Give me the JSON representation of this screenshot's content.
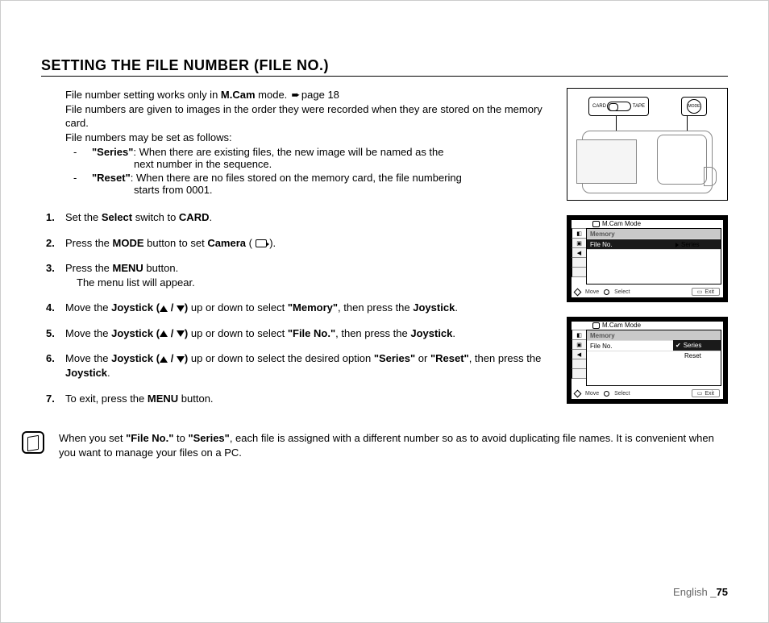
{
  "title": "SETTING THE FILE NUMBER (FILE NO.)",
  "intro": {
    "l1a": "File number setting works only in ",
    "l1b": "M.Cam",
    "l1c": " mode. ",
    "l1d": "page 18",
    "l2": "File numbers are given to images in the order they were recorded when they are stored on the memory card.",
    "l3": "File numbers may be set as follows:"
  },
  "options": [
    {
      "name": "\"Series\"",
      "desc1": ": When there are existing files, the new image will be named as the",
      "desc2": "next number in the sequence."
    },
    {
      "name": "\"Reset\"",
      "desc1": ": When there are no files stored on the memory card, the file numbering",
      "desc2": "starts from 0001."
    }
  ],
  "steps": {
    "s1a": "Set the ",
    "s1b": "Select",
    "s1c": " switch to ",
    "s1d": "CARD",
    "s1e": ".",
    "s2a": "Press the ",
    "s2b": "MODE",
    "s2c": " button to set ",
    "s2d": "Camera",
    "s2e": " ( ",
    "s2f": " ).",
    "s3a": "Press the ",
    "s3b": "MENU",
    "s3c": " button.",
    "s3sub": "The menu list will appear.",
    "s4a": "Move the ",
    "s4b": "Joystick (",
    "s4c": " / ",
    "s4d": ")",
    "s4e": " up or down to select ",
    "s4f": "\"Memory\"",
    "s4g": ", then press the ",
    "s4h": "Joystick",
    "s4i": ".",
    "s5a": "Move the ",
    "s5e": " up or down to select ",
    "s5f": "\"File No.\"",
    "s5g": ", then press the ",
    "s6a": "Move the ",
    "s6e": " up or down to select the desired option ",
    "s6f": "\"Series\"",
    "s6g": " or ",
    "s6h": "\"Reset\"",
    "s6i": ", then press the ",
    "s7a": "To exit, press the ",
    "s7b": "MENU",
    "s7c": " button."
  },
  "note": {
    "a": "When you set ",
    "b": "\"File No.\"",
    "c": " to ",
    "d": "\"Series\"",
    "e": ", each file is assigned with a different number so as to avoid duplicating file names. It is convenient when you want to manage your files on a PC."
  },
  "illus": {
    "card": "CARD",
    "tape": "TAPE",
    "mode": "MODE"
  },
  "lcd": {
    "mode": "M.Cam Mode",
    "cat": "Memory",
    "item": "File No.",
    "series": "Series",
    "reset": "Reset",
    "move": "Move",
    "select": "Select",
    "exit": "Exit"
  },
  "footer": {
    "lang": "English _",
    "page": "75"
  }
}
